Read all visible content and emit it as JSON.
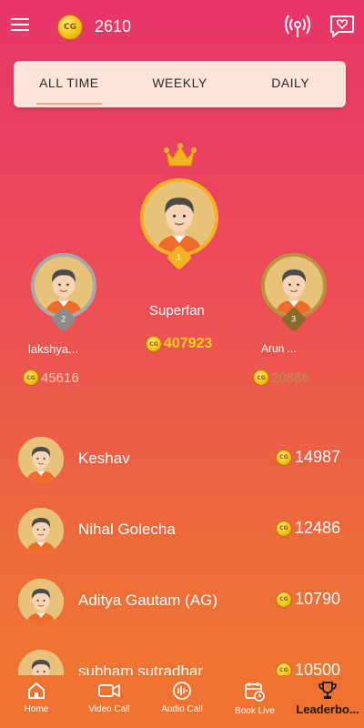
{
  "header": {
    "points": "2610",
    "coin_text": "CG"
  },
  "tabs": [
    {
      "label": "ALL TIME",
      "active": true
    },
    {
      "label": "WEEKLY",
      "active": false
    },
    {
      "label": "DAILY",
      "active": false
    }
  ],
  "podium": {
    "first": {
      "rank": "1",
      "name": "Superfan",
      "points": "407923"
    },
    "second": {
      "rank": "2",
      "name": "lakshya...",
      "points": "45616"
    },
    "third": {
      "rank": "3",
      "name": "Arun ...",
      "points": "20886"
    }
  },
  "leaders": [
    {
      "name": "Keshav",
      "points": "14987"
    },
    {
      "name": "Nihal Golecha",
      "points": "12486"
    },
    {
      "name": "Aditya Gautam (AG)",
      "points": "10790"
    },
    {
      "name": "subham sutradhar",
      "points": "10500"
    }
  ],
  "nav": [
    {
      "label": "Home",
      "icon": "home-icon"
    },
    {
      "label": "Video Call",
      "icon": "video-camera-icon"
    },
    {
      "label": "Audio Call",
      "icon": "audio-call-icon"
    },
    {
      "label": "Book Live",
      "icon": "calendar-clock-icon"
    },
    {
      "label": "Leaderbo...",
      "icon": "trophy-icon",
      "active": true
    }
  ],
  "colors": {
    "accent": "#ef7230",
    "gold": "#f5c21b",
    "silver": "#9a9a9a",
    "bronze": "#b08a3a"
  }
}
